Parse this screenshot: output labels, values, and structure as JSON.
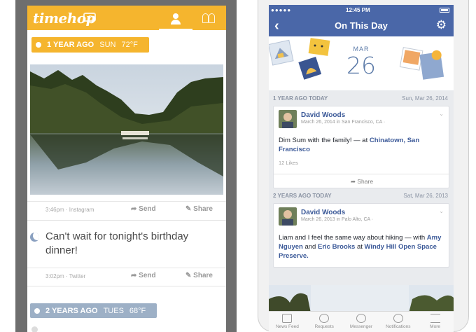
{
  "timehop": {
    "logo": "timehop",
    "date1": {
      "ago": "1 YEAR AGO",
      "day": "SUN",
      "temp": "72°F"
    },
    "post1_meta": "3:46pm · Instagram",
    "send_label": "Send",
    "share_label": "Share",
    "post2_text": "Can't wait for tonight's birthday dinner!",
    "post2_meta": "3:02pm · Twitter",
    "date2": {
      "ago": "2 YEARS AGO",
      "day": "TUES",
      "temp": "68°F"
    }
  },
  "facebook": {
    "status": {
      "carrier": "●●●●●",
      "time": "12:45 PM"
    },
    "title": "On This Day",
    "hero": {
      "month": "MAR",
      "day": "26"
    },
    "section1": {
      "label": "1 YEAR AGO TODAY",
      "date": "Sun, Mar 26, 2014"
    },
    "card1": {
      "name": "David Woods",
      "sub": "March 26, 2014 in San Francisco, CA ·",
      "text_a": "Dim Sum with the family! — at ",
      "text_b": "Chinatown, San Francisco",
      "likes": "12 Likes",
      "share": "Share"
    },
    "section2": {
      "label": "2 YEARS AGO TODAY",
      "date": "Sat, Mar 26, 2013"
    },
    "card2": {
      "name": "David Woods",
      "sub": "March 26, 2013 in Palo Alto, CA ·",
      "text_a": "Liam and I feel the same way about hiking — with ",
      "text_b": "Amy Nguyen",
      "text_c": " and ",
      "text_d": "Eric Brooks",
      "text_e": " at ",
      "text_f": "Windy Hill Open Space Preserve."
    },
    "tabs": [
      "News Feed",
      "Requests",
      "Messenger",
      "Notifications",
      "More"
    ]
  }
}
